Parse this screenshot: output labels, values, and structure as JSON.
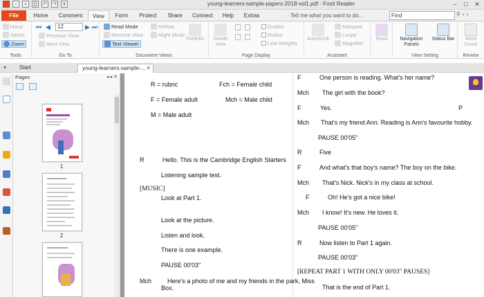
{
  "window": {
    "title": "young-learners-sample-papers-2018-vol1.pdf - Foxit Reader",
    "controls": [
      "–",
      "□",
      "✕"
    ]
  },
  "menu": {
    "tabs": [
      "File",
      "Home",
      "Comment",
      "View",
      "Form",
      "Protect",
      "Share",
      "Connect",
      "Help",
      "Extras"
    ],
    "active_tab": "View",
    "tell_me": "Tell me what you want to do...",
    "find_placeholder": "Find"
  },
  "ribbon": {
    "tools": {
      "label": "Tools",
      "items": [
        "Hand",
        "Select",
        "Zoom"
      ]
    },
    "goto": {
      "label": "Go To",
      "page_value": "12",
      "previous_view": "Previous View",
      "next_view": "Next View"
    },
    "document_views": {
      "label": "Document Views",
      "read_mode": "Read Mode",
      "reverse_view": "Reverse View",
      "text_viewer": "Text Viewer",
      "reflow": "Reflow",
      "night_mode": "Night Mode",
      "portfolio": "Portfolio"
    },
    "page_display": {
      "label": "Page Display",
      "rotate_view": "Rotate View",
      "guides": "Guides",
      "rulers": "Rulers",
      "line_weights": "Line Weights"
    },
    "assistant": {
      "label": "Assistant",
      "autoscroll": "AutoScroll",
      "marquee": "Marquee",
      "loupe": "Loupe",
      "magnifier": "Magnifier"
    },
    "read": "Read",
    "view_setting": {
      "label": "View Setting",
      "navigation_panels": "Navigation Panels",
      "status_bar": "Status Bar"
    },
    "review": {
      "label": "Review",
      "word_count": "Word Count"
    }
  },
  "doc_tabs": [
    {
      "label": "Start"
    },
    {
      "label": "young-learners-sample-..."
    }
  ],
  "pages_panel": {
    "title": "Pages",
    "thumbnails": [
      {
        "number": "1"
      },
      {
        "number": "2"
      }
    ]
  },
  "left_column": {
    "legend": [
      {
        "a": "R = rubric",
        "b": "Fch = Female child"
      },
      {
        "a": "F = Female adult",
        "b": "Mch = Male child"
      },
      {
        "a": "M = Male adult",
        "b": ""
      }
    ],
    "lines": [
      {
        "speaker": "R",
        "text": "Hello. This is the Cambridge English Starters"
      },
      {
        "speaker": "",
        "text": "Listening sample test."
      },
      {
        "speaker": "[MUSIC]",
        "text": ""
      },
      {
        "speaker": "",
        "text": "Look at Part 1."
      },
      {
        "speaker": "",
        "text": "Look at the picture."
      },
      {
        "speaker": "",
        "text": "Listen and look."
      },
      {
        "speaker": "",
        "text": "There is one example."
      },
      {
        "speaker": "",
        "text": "PAUSE 00'03\""
      },
      {
        "speaker": "Mch",
        "text": "Here's a photo of me and my friends in the park, Miss"
      },
      {
        "speaker": "",
        "text": "Box."
      }
    ]
  },
  "right_column": {
    "lines": [
      {
        "speaker": "F",
        "text": "One person is reading. What's her name?"
      },
      {
        "speaker": "Mch",
        "text": "The girl with the book?"
      },
      {
        "speaker": "F",
        "text": "Yes."
      },
      {
        "speaker": "Mch",
        "text": "That's my friend Ann. Reading is Ann's favourite hobby."
      },
      {
        "speaker": "",
        "text": "PAUSE 00'05\""
      },
      {
        "speaker": "R",
        "text": "Five"
      },
      {
        "speaker": "F",
        "text": "And what's that boy's name? The boy on the bike."
      },
      {
        "speaker": "Mch",
        "text": "That's Nick. Nick's in my class at school."
      },
      {
        "speaker": "F",
        "text": "Oh! He's got a nice bike!"
      },
      {
        "speaker": "Mch",
        "text": "I know! It's new. He loves it."
      },
      {
        "speaker": "",
        "text": "PAUSE 00'05\""
      },
      {
        "speaker": "R",
        "text": "Now listen to Part 1 again."
      },
      {
        "speaker": "",
        "text": "PAUSE 00'03\""
      },
      {
        "speaker": "",
        "text": "[REPEAT PART 1 WITH ONLY 00'03\" PAUSES]"
      },
      {
        "speaker": "",
        "text": "That is the end of Part 1."
      }
    ],
    "stray_letter": "P"
  }
}
